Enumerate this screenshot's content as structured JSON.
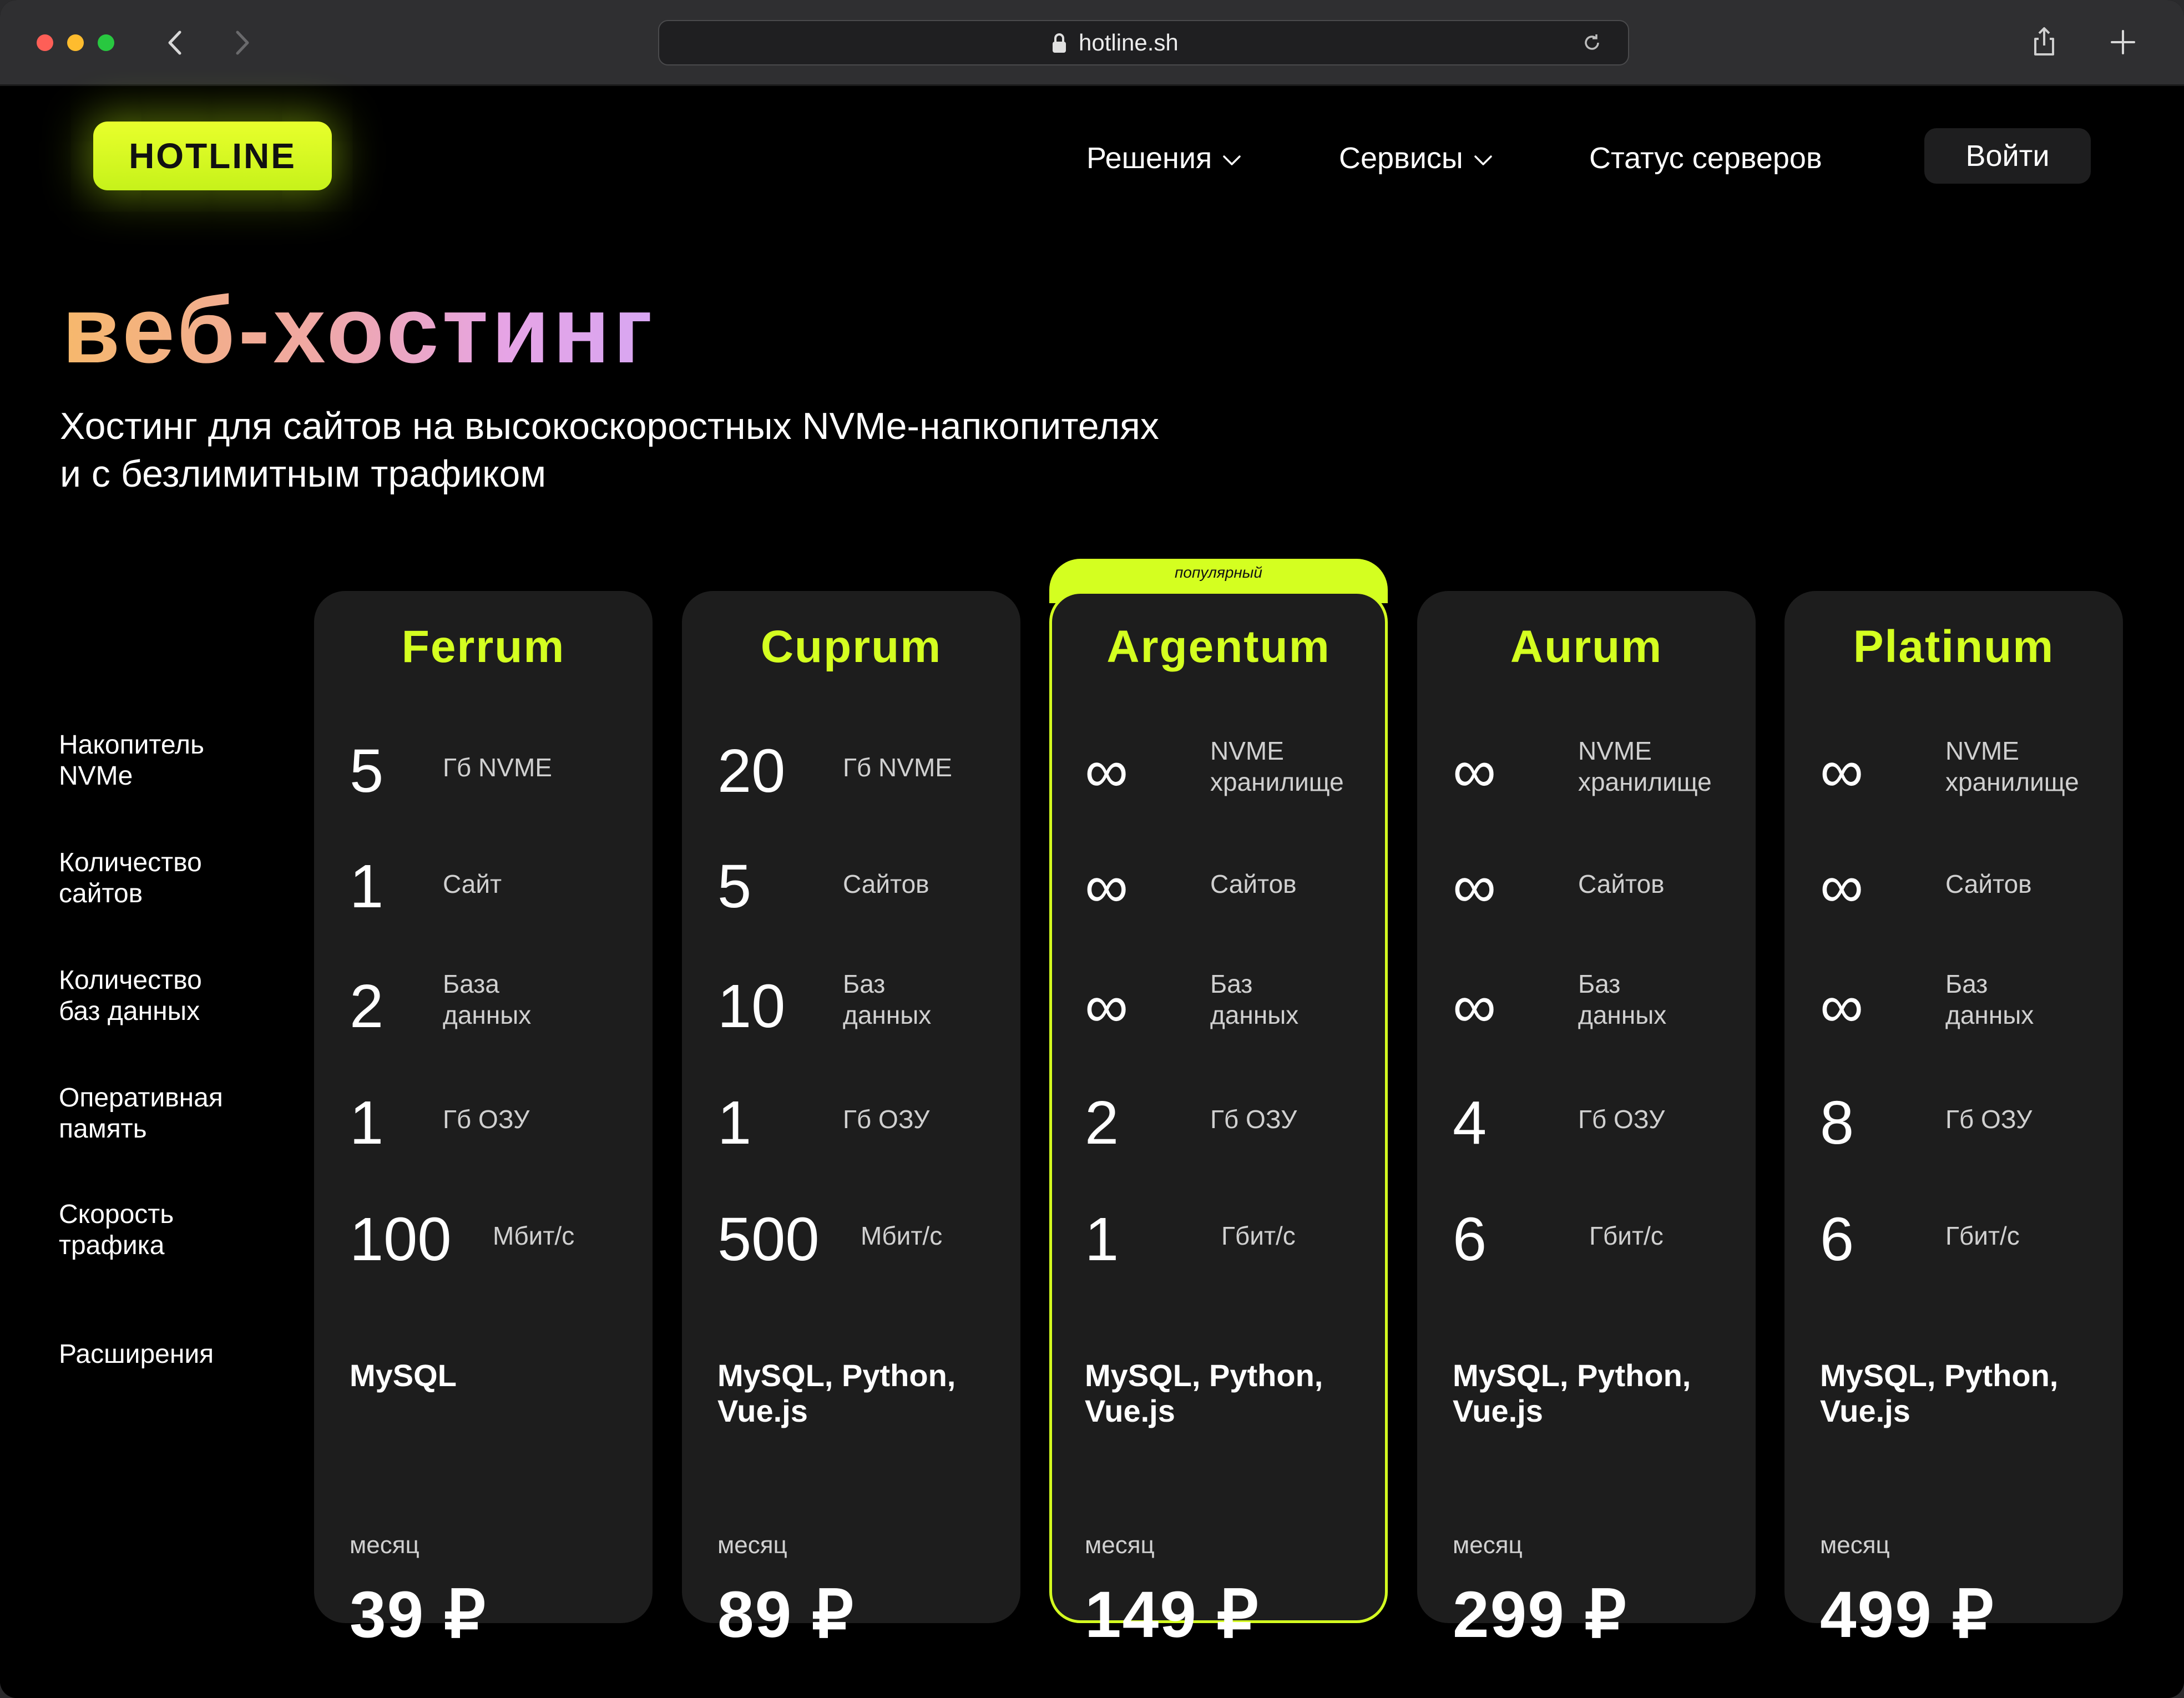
{
  "browser": {
    "url": "hotline.sh"
  },
  "header": {
    "logo": "HOTLINE",
    "nav": [
      {
        "label": "Решения",
        "has_dropdown": true
      },
      {
        "label": "Сервисы",
        "has_dropdown": true
      },
      {
        "label": "Статус серверов",
        "has_dropdown": false
      }
    ],
    "login": "Войти"
  },
  "hero": {
    "title": "веб-хостинг",
    "subtitle_line1": "Хостинг для сайтов на высокоскоростных NVMe-напкопителях",
    "subtitle_line2": "и с безлимитным трафиком"
  },
  "features": [
    {
      "line1": "Накопитель",
      "line2": "NVMe"
    },
    {
      "line1": "Количество",
      "line2": "сайтов"
    },
    {
      "line1": "Количество",
      "line2": "баз данных"
    },
    {
      "line1": "Оперативная",
      "line2": "память"
    },
    {
      "line1": "Скорость",
      "line2": "трафика"
    },
    {
      "line1": "Расширения",
      "line2": ""
    }
  ],
  "popular_badge": "популярный",
  "plans": [
    {
      "name": "Ferrum",
      "rows": [
        {
          "value": "5",
          "unit1": "Гб NVME",
          "unit2": ""
        },
        {
          "value": "1",
          "unit1": "Сайт",
          "unit2": ""
        },
        {
          "value": "2",
          "unit1": "База",
          "unit2": "данных"
        },
        {
          "value": "1",
          "unit1": "Гб ОЗУ",
          "unit2": ""
        },
        {
          "value": "100",
          "unit1": "Мбит/с",
          "unit2": ""
        }
      ],
      "ext_line1": "MySQL",
      "ext_line2": "",
      "period": "месяц",
      "price": "39 ₽"
    },
    {
      "name": "Cuprum",
      "rows": [
        {
          "value": "20",
          "unit1": "Гб NVME",
          "unit2": ""
        },
        {
          "value": "5",
          "unit1": "Сайтов",
          "unit2": ""
        },
        {
          "value": "10",
          "unit1": "Баз",
          "unit2": "данных"
        },
        {
          "value": "1",
          "unit1": "Гб ОЗУ",
          "unit2": ""
        },
        {
          "value": "500",
          "unit1": "Мбит/с",
          "unit2": ""
        }
      ],
      "ext_line1": "MySQL, Python,",
      "ext_line2": "Vue.js",
      "period": "месяц",
      "price": "89 ₽"
    },
    {
      "name": "Argentum",
      "rows": [
        {
          "value": "∞",
          "unit1": "NVME",
          "unit2": "хранилище"
        },
        {
          "value": "∞",
          "unit1": "Сайтов",
          "unit2": ""
        },
        {
          "value": "∞",
          "unit1": "Баз",
          "unit2": "данных"
        },
        {
          "value": "2",
          "unit1": "Гб ОЗУ",
          "unit2": ""
        },
        {
          "value": "1",
          "unit1": "Гбит/с",
          "unit2": ""
        }
      ],
      "ext_line1": "MySQL, Python,",
      "ext_line2": "Vue.js",
      "period": "месяц",
      "price": "149 ₽"
    },
    {
      "name": "Aurum",
      "rows": [
        {
          "value": "∞",
          "unit1": "NVME",
          "unit2": "хранилище"
        },
        {
          "value": "∞",
          "unit1": "Сайтов",
          "unit2": ""
        },
        {
          "value": "∞",
          "unit1": "Баз",
          "unit2": "данных"
        },
        {
          "value": "4",
          "unit1": "Гб ОЗУ",
          "unit2": ""
        },
        {
          "value": "6",
          "unit1": "Гбит/с",
          "unit2": ""
        }
      ],
      "ext_line1": "MySQL, Python,",
      "ext_line2": "Vue.js",
      "period": "месяц",
      "price": "299 ₽"
    },
    {
      "name": "Platinum",
      "rows": [
        {
          "value": "∞",
          "unit1": "NVME",
          "unit2": "хранилище"
        },
        {
          "value": "∞",
          "unit1": "Сайтов",
          "unit2": ""
        },
        {
          "value": "∞",
          "unit1": "Баз",
          "unit2": "данных"
        },
        {
          "value": "8",
          "unit1": "Гб ОЗУ",
          "unit2": ""
        },
        {
          "value": "6",
          "unit1": "Гбит/с",
          "unit2": ""
        }
      ],
      "ext_line1": "MySQL, Python,",
      "ext_line2": "Vue.js",
      "period": "месяц",
      "price": "499 ₽"
    }
  ],
  "colors": {
    "accent": "#d4ff20",
    "card_bg": "#1d1d1d",
    "page_bg": "#000000"
  }
}
